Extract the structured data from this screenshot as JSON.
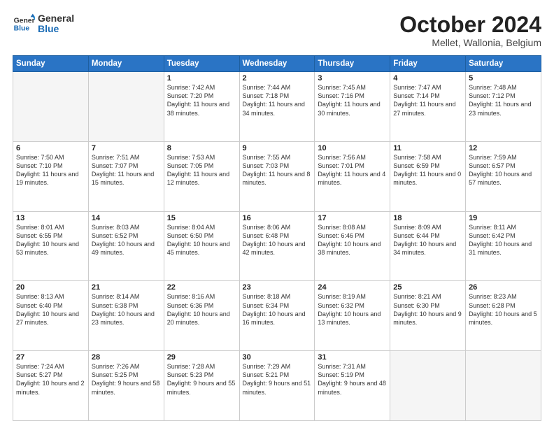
{
  "header": {
    "logo_line1": "General",
    "logo_line2": "Blue",
    "title": "October 2024",
    "subtitle": "Mellet, Wallonia, Belgium"
  },
  "days_of_week": [
    "Sunday",
    "Monday",
    "Tuesday",
    "Wednesday",
    "Thursday",
    "Friday",
    "Saturday"
  ],
  "weeks": [
    [
      {
        "day": "",
        "empty": true
      },
      {
        "day": "",
        "empty": true
      },
      {
        "day": "1",
        "sunrise": "7:42 AM",
        "sunset": "7:20 PM",
        "daylight": "11 hours and 38 minutes."
      },
      {
        "day": "2",
        "sunrise": "7:44 AM",
        "sunset": "7:18 PM",
        "daylight": "11 hours and 34 minutes."
      },
      {
        "day": "3",
        "sunrise": "7:45 AM",
        "sunset": "7:16 PM",
        "daylight": "11 hours and 30 minutes."
      },
      {
        "day": "4",
        "sunrise": "7:47 AM",
        "sunset": "7:14 PM",
        "daylight": "11 hours and 27 minutes."
      },
      {
        "day": "5",
        "sunrise": "7:48 AM",
        "sunset": "7:12 PM",
        "daylight": "11 hours and 23 minutes."
      }
    ],
    [
      {
        "day": "6",
        "sunrise": "7:50 AM",
        "sunset": "7:10 PM",
        "daylight": "11 hours and 19 minutes."
      },
      {
        "day": "7",
        "sunrise": "7:51 AM",
        "sunset": "7:07 PM",
        "daylight": "11 hours and 15 minutes."
      },
      {
        "day": "8",
        "sunrise": "7:53 AM",
        "sunset": "7:05 PM",
        "daylight": "11 hours and 12 minutes."
      },
      {
        "day": "9",
        "sunrise": "7:55 AM",
        "sunset": "7:03 PM",
        "daylight": "11 hours and 8 minutes."
      },
      {
        "day": "10",
        "sunrise": "7:56 AM",
        "sunset": "7:01 PM",
        "daylight": "11 hours and 4 minutes."
      },
      {
        "day": "11",
        "sunrise": "7:58 AM",
        "sunset": "6:59 PM",
        "daylight": "11 hours and 0 minutes."
      },
      {
        "day": "12",
        "sunrise": "7:59 AM",
        "sunset": "6:57 PM",
        "daylight": "10 hours and 57 minutes."
      }
    ],
    [
      {
        "day": "13",
        "sunrise": "8:01 AM",
        "sunset": "6:55 PM",
        "daylight": "10 hours and 53 minutes."
      },
      {
        "day": "14",
        "sunrise": "8:03 AM",
        "sunset": "6:52 PM",
        "daylight": "10 hours and 49 minutes."
      },
      {
        "day": "15",
        "sunrise": "8:04 AM",
        "sunset": "6:50 PM",
        "daylight": "10 hours and 45 minutes."
      },
      {
        "day": "16",
        "sunrise": "8:06 AM",
        "sunset": "6:48 PM",
        "daylight": "10 hours and 42 minutes."
      },
      {
        "day": "17",
        "sunrise": "8:08 AM",
        "sunset": "6:46 PM",
        "daylight": "10 hours and 38 minutes."
      },
      {
        "day": "18",
        "sunrise": "8:09 AM",
        "sunset": "6:44 PM",
        "daylight": "10 hours and 34 minutes."
      },
      {
        "day": "19",
        "sunrise": "8:11 AM",
        "sunset": "6:42 PM",
        "daylight": "10 hours and 31 minutes."
      }
    ],
    [
      {
        "day": "20",
        "sunrise": "8:13 AM",
        "sunset": "6:40 PM",
        "daylight": "10 hours and 27 minutes."
      },
      {
        "day": "21",
        "sunrise": "8:14 AM",
        "sunset": "6:38 PM",
        "daylight": "10 hours and 23 minutes."
      },
      {
        "day": "22",
        "sunrise": "8:16 AM",
        "sunset": "6:36 PM",
        "daylight": "10 hours and 20 minutes."
      },
      {
        "day": "23",
        "sunrise": "8:18 AM",
        "sunset": "6:34 PM",
        "daylight": "10 hours and 16 minutes."
      },
      {
        "day": "24",
        "sunrise": "8:19 AM",
        "sunset": "6:32 PM",
        "daylight": "10 hours and 13 minutes."
      },
      {
        "day": "25",
        "sunrise": "8:21 AM",
        "sunset": "6:30 PM",
        "daylight": "10 hours and 9 minutes."
      },
      {
        "day": "26",
        "sunrise": "8:23 AM",
        "sunset": "6:28 PM",
        "daylight": "10 hours and 5 minutes."
      }
    ],
    [
      {
        "day": "27",
        "sunrise": "7:24 AM",
        "sunset": "5:27 PM",
        "daylight": "10 hours and 2 minutes."
      },
      {
        "day": "28",
        "sunrise": "7:26 AM",
        "sunset": "5:25 PM",
        "daylight": "9 hours and 58 minutes."
      },
      {
        "day": "29",
        "sunrise": "7:28 AM",
        "sunset": "5:23 PM",
        "daylight": "9 hours and 55 minutes."
      },
      {
        "day": "30",
        "sunrise": "7:29 AM",
        "sunset": "5:21 PM",
        "daylight": "9 hours and 51 minutes."
      },
      {
        "day": "31",
        "sunrise": "7:31 AM",
        "sunset": "5:19 PM",
        "daylight": "9 hours and 48 minutes."
      },
      {
        "day": "",
        "empty": true
      },
      {
        "day": "",
        "empty": true
      }
    ]
  ]
}
